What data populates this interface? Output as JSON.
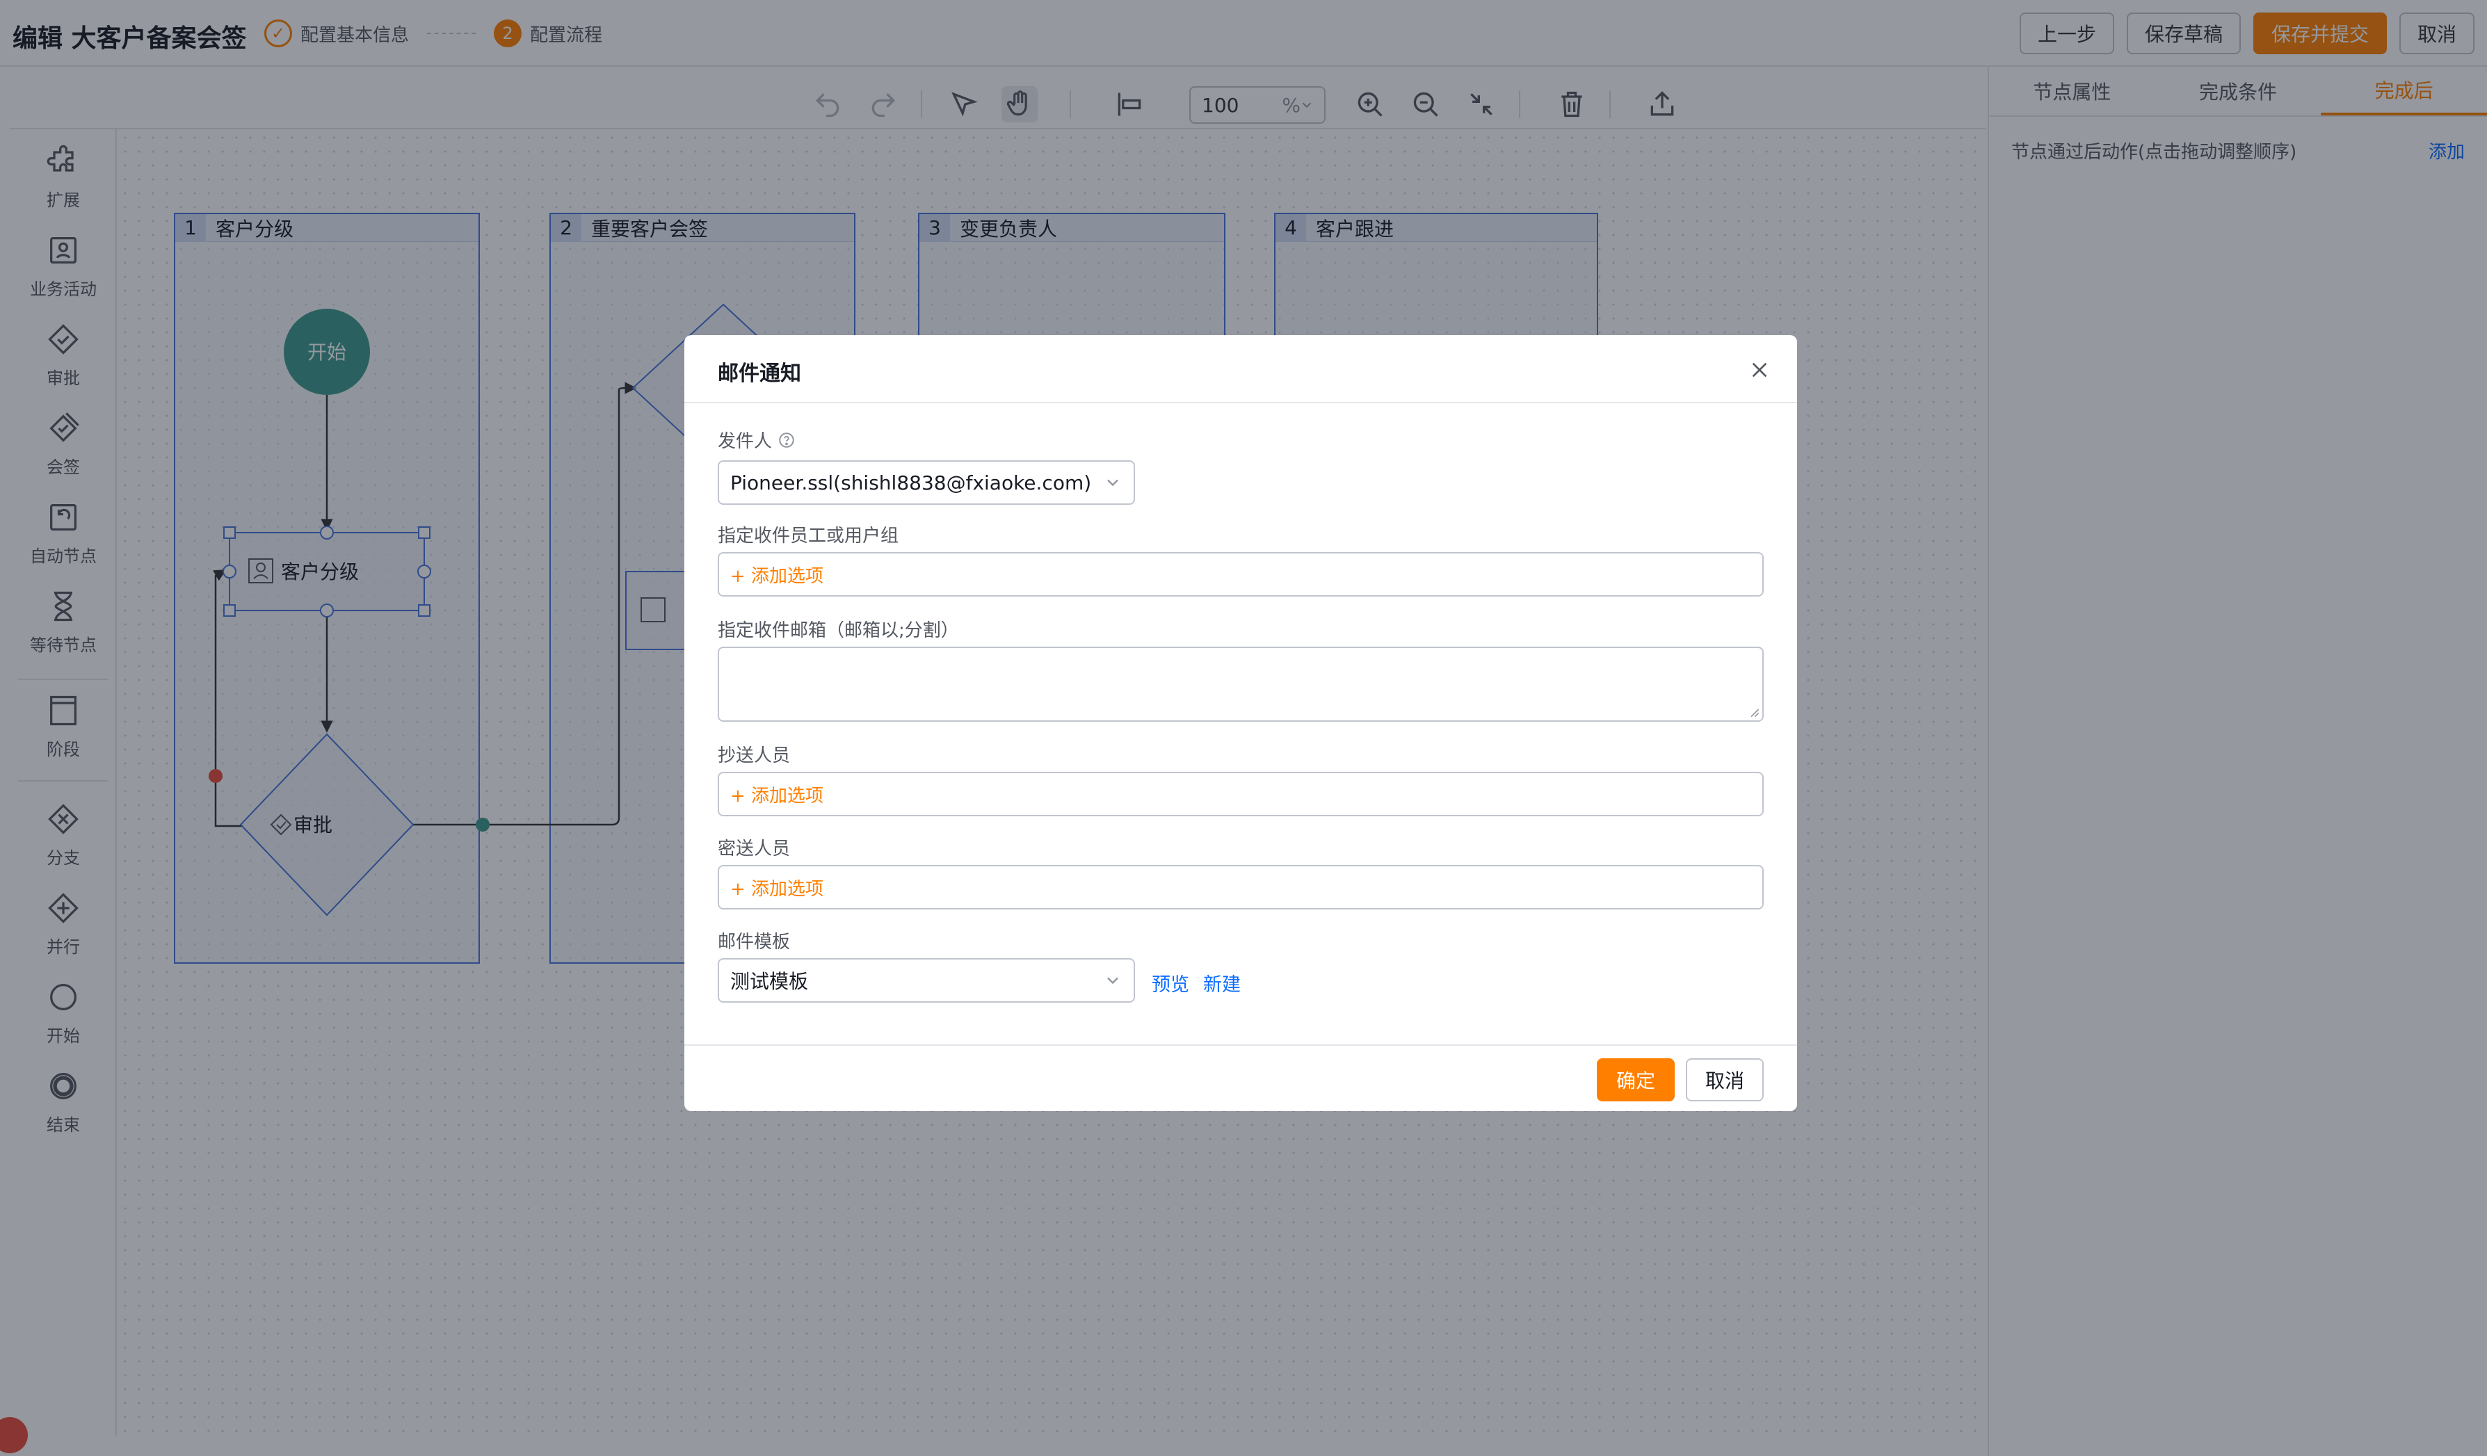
{
  "header": {
    "title": "编辑 大客户备案会签",
    "steps": [
      {
        "number": "✓",
        "label": "配置基本信息",
        "state": "done"
      },
      {
        "number": "2",
        "label": "配置流程",
        "state": "active"
      }
    ],
    "buttons": {
      "prev": "上一步",
      "save_draft": "保存草稿",
      "save_submit": "保存并提交",
      "cancel": "取消"
    }
  },
  "toolbar": {
    "zoom_value": "100",
    "zoom_unit": "%"
  },
  "sidebar": {
    "tools": [
      {
        "label": "扩展",
        "icon": "puzzle-icon"
      },
      {
        "label": "业务活动",
        "icon": "business-activity-icon"
      },
      {
        "label": "审批",
        "icon": "approval-icon"
      },
      {
        "label": "会签",
        "icon": "countersign-icon"
      },
      {
        "label": "自动节点",
        "icon": "auto-node-icon"
      },
      {
        "label": "等待节点",
        "icon": "hourglass-icon"
      },
      {
        "label": "阶段",
        "icon": "stage-icon"
      },
      {
        "label": "分支",
        "icon": "branch-icon"
      },
      {
        "label": "并行",
        "icon": "parallel-icon"
      },
      {
        "label": "开始",
        "icon": "start-icon"
      },
      {
        "label": "结束",
        "icon": "end-icon"
      }
    ]
  },
  "canvas": {
    "lanes": [
      {
        "number": "1",
        "title": "客户分级"
      },
      {
        "number": "2",
        "title": "重要客户会签"
      },
      {
        "number": "3",
        "title": "变更负责人"
      },
      {
        "number": "4",
        "title": "客户跟进"
      }
    ],
    "nodes": {
      "start": "开始",
      "task": "客户分级",
      "approval": "审批"
    }
  },
  "right_panel": {
    "tabs": [
      {
        "label": "节点属性",
        "active": false
      },
      {
        "label": "完成条件",
        "active": false
      },
      {
        "label": "完成后",
        "active": true
      }
    ],
    "row_text": "节点通过后动作(点击拖动调整顺序)",
    "add_link": "添加"
  },
  "modal": {
    "title": "邮件通知",
    "sender_label": "发件人",
    "sender_value": "Pioneer.ssl(shishl8838@fxiaoke.com)",
    "recipients_label": "指定收件员工或用户组",
    "recipients_add": "+ 添加选项",
    "emails_label": "指定收件邮箱（邮箱以;分割）",
    "emails_value": "",
    "cc_label": "抄送人员",
    "cc_add": "+ 添加选项",
    "bcc_label": "密送人员",
    "bcc_add": "+ 添加选项",
    "template_label": "邮件模板",
    "template_value": "测试模板",
    "preview_link": "预览",
    "new_link": "新建",
    "confirm": "确定",
    "cancel": "取消"
  },
  "colors": {
    "accent": "#ff8000",
    "link": "#0c6cff",
    "lane_border": "#4876d9",
    "start_node": "#3d9b8f"
  }
}
